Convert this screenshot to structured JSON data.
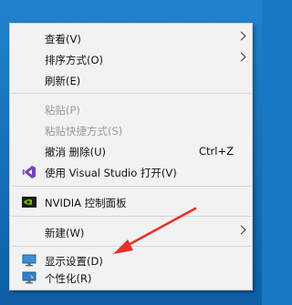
{
  "context_menu": {
    "items": [
      {
        "label": "查看(V)",
        "submenu": true,
        "disabled": false
      },
      {
        "label": "排序方式(O)",
        "submenu": true,
        "disabled": false
      },
      {
        "label": "刷新(E)",
        "submenu": false,
        "disabled": false
      },
      {
        "label": "粘贴(P)",
        "submenu": false,
        "disabled": true
      },
      {
        "label": "粘贴快捷方式(S)",
        "submenu": false,
        "disabled": true
      },
      {
        "label": "撤消 删除(U)",
        "shortcut": "Ctrl+Z",
        "submenu": false,
        "disabled": false
      },
      {
        "label": "使用 Visual Studio 打开(V)",
        "icon": "visual-studio-icon",
        "submenu": false,
        "disabled": false
      },
      {
        "label": "NVIDIA 控制面板",
        "icon": "nvidia-icon",
        "submenu": false,
        "disabled": false
      },
      {
        "label": "新建(W)",
        "submenu": true,
        "disabled": false
      },
      {
        "label": "显示设置(D)",
        "icon": "display-settings-icon",
        "submenu": false,
        "disabled": false
      },
      {
        "label": "个性化(R)",
        "icon": "personalize-icon",
        "submenu": false,
        "disabled": false
      }
    ]
  },
  "annotation": {
    "color": "#e8302a"
  }
}
